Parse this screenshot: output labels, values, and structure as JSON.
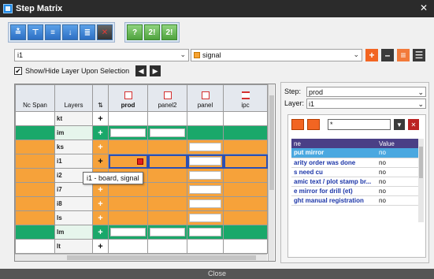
{
  "window": {
    "title": "Step Matrix",
    "close_button": "Close"
  },
  "toolbar": {
    "group1": [
      "≛",
      "⊤",
      "≡",
      "↓",
      "≣",
      "✕"
    ],
    "group2": [
      "?",
      "2!",
      "2!"
    ]
  },
  "layer_selector": {
    "current": "i1",
    "signal_value": "signal"
  },
  "show_hide": {
    "label": "Show/Hide Layer Upon Selection",
    "checked": "✔"
  },
  "grid": {
    "headers": {
      "ncspan": "Nc Span",
      "layers": "Layers",
      "steps": [
        "prod",
        "panel2",
        "panel",
        "ipc"
      ]
    },
    "rows": [
      {
        "name": "kt",
        "type": "white"
      },
      {
        "name": "im",
        "type": "green"
      },
      {
        "name": "ks",
        "type": "orange"
      },
      {
        "name": "i1",
        "type": "sel"
      },
      {
        "name": "i2",
        "type": "orange"
      },
      {
        "name": "i7",
        "type": "orange"
      },
      {
        "name": "i8",
        "type": "orange"
      },
      {
        "name": "ls",
        "type": "orange"
      },
      {
        "name": "lm",
        "type": "green"
      },
      {
        "name": "lt",
        "type": "white"
      }
    ],
    "tooltip": "i1 - board, signal"
  },
  "right_panel": {
    "step_label": "Step:",
    "step_value": "prod",
    "layer_label": "Layer:",
    "layer_value": "i1",
    "search_value": "*",
    "attributes": {
      "headers": [
        "ne",
        "Value"
      ],
      "rows": [
        {
          "name": "put mirror",
          "value": "no",
          "highlight": true
        },
        {
          "name": "arity order was done",
          "value": "no"
        },
        {
          "name": "s need cu",
          "value": "no"
        },
        {
          "name": "amic text / plot stamp br...",
          "value": "no"
        },
        {
          "name": "e mirror for drill (et)",
          "value": "no"
        },
        {
          "name": "ght manual registration",
          "value": "no"
        }
      ]
    }
  },
  "colors": {
    "green": "#1aa86a",
    "orange": "#f6a23a",
    "accent": "#f26522"
  }
}
